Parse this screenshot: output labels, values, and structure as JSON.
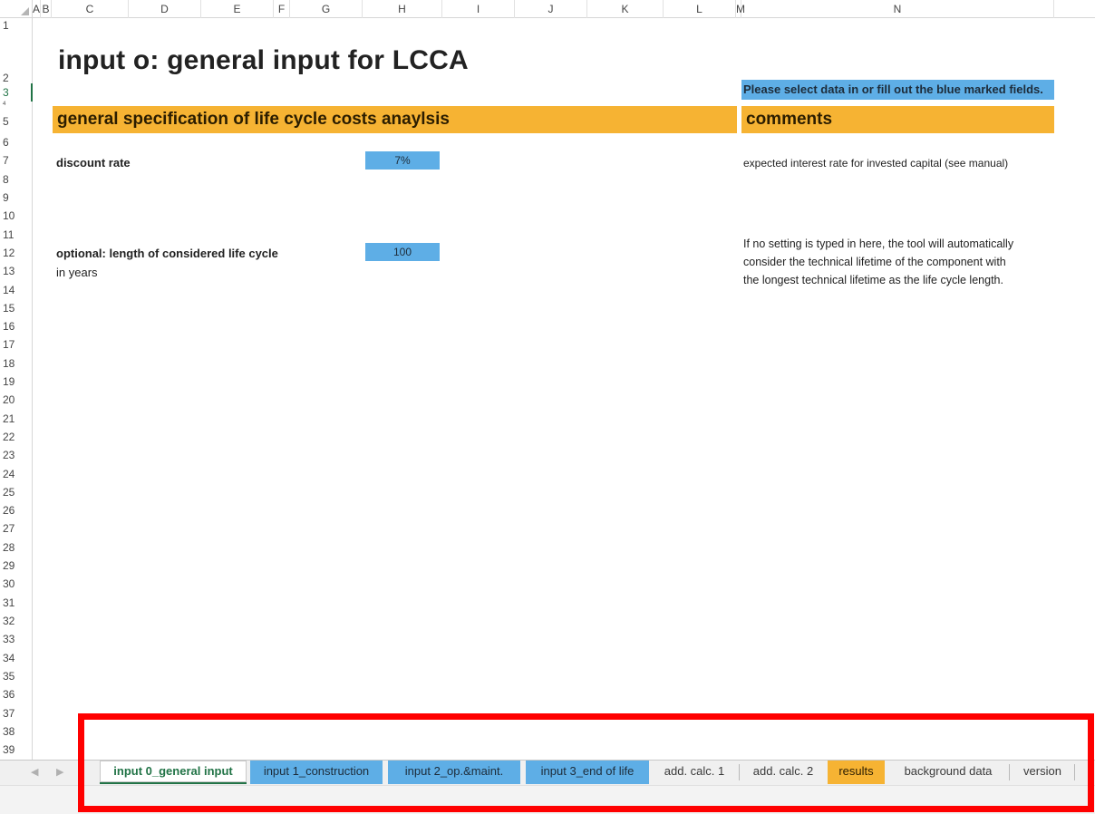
{
  "columns": [
    "A",
    "B",
    "C",
    "D",
    "E",
    "F",
    "G",
    "H",
    "I",
    "J",
    "K",
    "L",
    "M",
    "N"
  ],
  "rows": [
    "1",
    "2",
    "3",
    "4",
    "5",
    "6",
    "7",
    "8",
    "9",
    "10",
    "11",
    "12",
    "13",
    "14",
    "15",
    "16",
    "17",
    "18",
    "19",
    "20",
    "21",
    "22",
    "23",
    "24",
    "25",
    "26",
    "27",
    "28",
    "29",
    "30",
    "31",
    "32",
    "33",
    "34",
    "35",
    "36",
    "37",
    "38",
    "39"
  ],
  "sheet": {
    "title": "input o: general input for LCCA",
    "note": "Please select data in or fill out the blue marked fields.",
    "section_header": "general specification of life cycle costs anaylsis",
    "comments_header": "comments",
    "discount_rate_label": "discount rate",
    "discount_rate_value": "7%",
    "discount_rate_comment": "expected interest rate for invested capital (see manual)",
    "life_cycle_label": "optional: length of considered life cycle",
    "life_cycle_unit": "in years",
    "life_cycle_value": "100",
    "life_cycle_comment_1": "If no setting is typed in here, the tool will automatically",
    "life_cycle_comment_2": "consider the technical lifetime of the component with",
    "life_cycle_comment_3": "the longest technical lifetime as the life cycle length."
  },
  "tabs": [
    {
      "label": "input 0_general input",
      "style": "active"
    },
    {
      "label": "input 1_construction",
      "style": "blue"
    },
    {
      "label": "input 2_op.&maint.",
      "style": "blue"
    },
    {
      "label": "input 3_end of life",
      "style": "blue"
    },
    {
      "label": "add. calc. 1",
      "style": "plain"
    },
    {
      "label": "add. calc. 2",
      "style": "plain"
    },
    {
      "label": "results",
      "style": "orange"
    },
    {
      "label": "background data",
      "style": "plain"
    },
    {
      "label": "version",
      "style": "plain"
    }
  ],
  "nav": {
    "prev_icon": "chevron-left-icon",
    "next_icon": "chevron-right-icon"
  },
  "colors": {
    "input_blue": "#5eaee6",
    "header_orange": "#f6b333",
    "excel_green": "#217346",
    "highlight_red": "#ff0000"
  }
}
